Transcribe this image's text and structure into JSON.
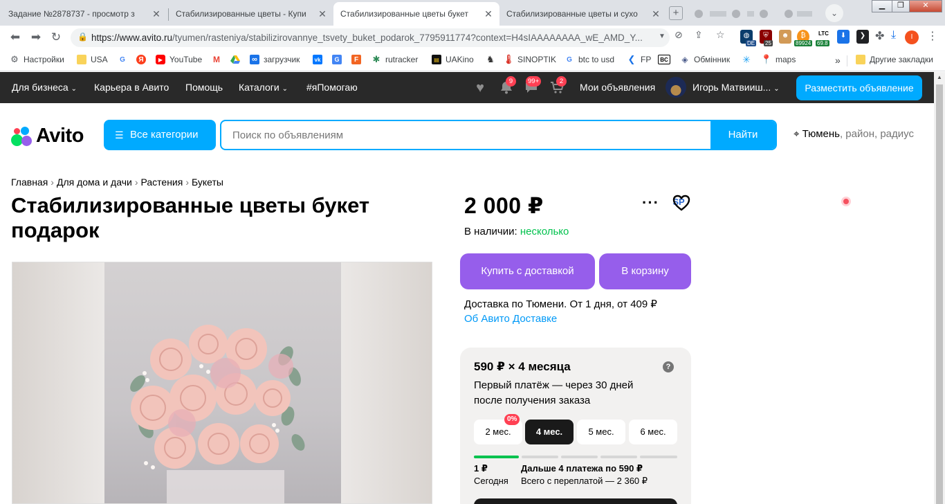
{
  "browser": {
    "tabs": [
      {
        "title": "Задание №2878737 - просмотр з",
        "favicon": "SP"
      },
      {
        "title": "Стабилизированные цветы - Купи",
        "favicon": "●"
      },
      {
        "title": "Стабилизированные цветы букет",
        "favicon": "avito"
      },
      {
        "title": "Стабилизированные цветы и сухо",
        "favicon": "loading"
      }
    ],
    "url_host": "https://www.avito.ru",
    "url_path": "/tyumen/rasteniya/stabilizirovannye_tsvety_buket_podarok_7795911774?context=H4sIAAAAAAAA_wE_AMD_Y...",
    "extension_badges": {
      "de": "DE",
      "count": "25",
      "price1": "89924",
      "ltc_label": "LTC",
      "ltc_value": "69.8"
    },
    "profile_initial": "I"
  },
  "bookmarks": [
    {
      "label": "Настройки",
      "icon": "gear-icon"
    },
    {
      "label": "USA",
      "icon": "folder-icon"
    },
    {
      "label": "",
      "icon": "google-icon"
    },
    {
      "label": "",
      "icon": "yandex-icon"
    },
    {
      "label": "YouTube",
      "icon": "youtube-icon"
    },
    {
      "label": "",
      "icon": "gmail-icon"
    },
    {
      "label": "",
      "icon": "drive-icon"
    },
    {
      "label": "загрузчик",
      "icon": "infinity-icon"
    },
    {
      "label": "",
      "icon": "vk-icon"
    },
    {
      "label": "",
      "icon": "translate-icon"
    },
    {
      "label": "",
      "icon": "f-icon"
    },
    {
      "label": "rutracker",
      "icon": "rutracker-icon"
    },
    {
      "label": "UAKino",
      "icon": "uakino-icon"
    },
    {
      "label": "",
      "icon": "chess-icon"
    },
    {
      "label": "SINOPTIK",
      "icon": "thermometer-icon"
    },
    {
      "label": "btc to usd",
      "icon": "google-icon"
    },
    {
      "label": "FP",
      "icon": "fp-icon"
    },
    {
      "label": "",
      "icon": "bc-icon"
    },
    {
      "label": "Обмінник",
      "icon": "exchange-icon"
    },
    {
      "label": "",
      "icon": "sparkle-icon"
    },
    {
      "label": "maps",
      "icon": "maps-icon"
    },
    {
      "label": "Другие закладки",
      "icon": "folder-icon"
    }
  ],
  "avito_header": {
    "for_business": "Для бизнеса",
    "careers": "Карьера в Авито",
    "help": "Помощь",
    "catalogs": "Каталоги",
    "i_help": "#яПомогаю",
    "notif_count": "9",
    "msg_count": "99+",
    "cart_count": "2",
    "my_ads": "Мои объявления",
    "user_name": "Игорь Матвииш...",
    "post_ad": "Разместить объявление"
  },
  "search": {
    "logo": "Avito",
    "all_categories": "Все категории",
    "placeholder": "Поиск по объявлениям",
    "find": "Найти",
    "city": "Тюмень",
    "region_hint": ", район, радиус"
  },
  "breadcrumbs": [
    "Главная",
    "Для дома и дачи",
    "Растения",
    "Букеты"
  ],
  "listing": {
    "title": "Стабилизированные цветы букет подарок",
    "price": "2 000 ₽",
    "availability_label": "В наличии:",
    "availability_value": "несколько",
    "buy_delivery": "Купить с доставкой",
    "add_to_cart": "В корзину",
    "delivery_text": "Доставка по Тюмени. От 1 дня, от 409 ₽",
    "delivery_link": "Об Авито Доставке"
  },
  "installments": {
    "headline": "590 ₽ × 4 месяца",
    "description": "Первый платёж — через 30 дней после получения заказа",
    "options": [
      "2 мес.",
      "4 мес.",
      "5 мес.",
      "6 мес."
    ],
    "selected_index": 1,
    "promo_badge": "0%",
    "first_amount": "1 ₽",
    "first_label": "Сегодня",
    "next_label": "Дальше 4 платежа по 590 ₽",
    "total_label": "Всего с переплатой — 2 360 ₽"
  },
  "colors": {
    "avito_blue": "#00aaff",
    "avito_purple": "#965eeb",
    "in_stock_green": "#02c24e",
    "badge_red": "#ff4053",
    "header_dark": "#292929"
  }
}
